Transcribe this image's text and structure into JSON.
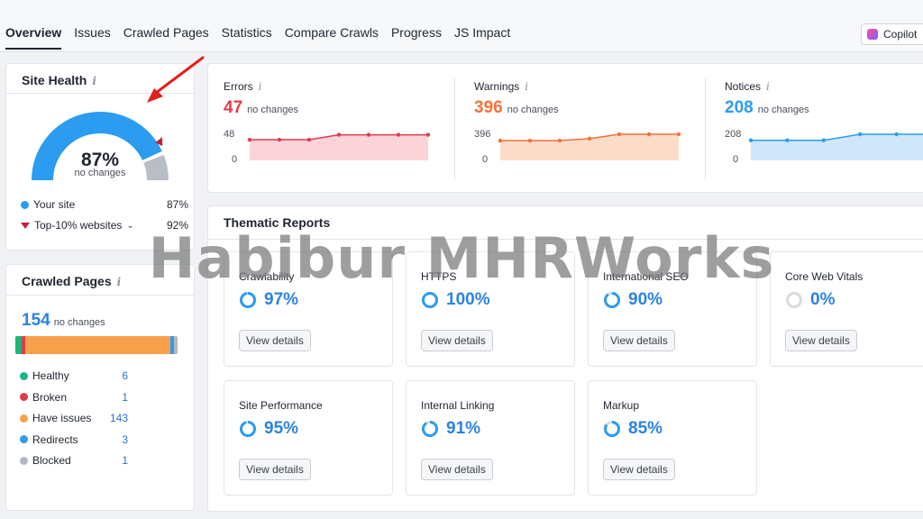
{
  "tabs": [
    "Overview",
    "Issues",
    "Crawled Pages",
    "Statistics",
    "Compare Crawls",
    "Progress",
    "JS Impact"
  ],
  "copilot": {
    "label": "Copilot"
  },
  "site_health": {
    "title": "Site Health",
    "info_icon": "i",
    "percent": "87%",
    "note": "no changes",
    "gauge_fraction": 0.87,
    "legend": [
      {
        "label": "Your site",
        "value": "87%",
        "color": "#2b9cf0"
      },
      {
        "label": "Top-10% websites",
        "value": "92%",
        "color": "#c4203b"
      }
    ]
  },
  "crawled_pages": {
    "title": "Crawled Pages",
    "info_icon": "i",
    "total": "154",
    "note": "no changes",
    "stats": [
      {
        "label": "Healthy",
        "count": "6",
        "color": "#1db57a"
      },
      {
        "label": "Broken",
        "count": "1",
        "color": "#e23b4a"
      },
      {
        "label": "Have issues",
        "count": "143",
        "color": "#f7a14c"
      },
      {
        "label": "Redirects",
        "count": "3",
        "color": "#2b9cf0"
      },
      {
        "label": "Blocked",
        "count": "1",
        "color": "#b3b8c2"
      }
    ]
  },
  "metrics": [
    {
      "label": "Errors",
      "value": "47",
      "note": "no changes",
      "color": "#e23b4a",
      "fill": "#fbd3d8",
      "axis_top": "48",
      "axis_bottom": "0",
      "series": [
        38,
        38,
        38,
        47,
        47,
        47,
        47
      ]
    },
    {
      "label": "Warnings",
      "value": "396",
      "note": "no changes",
      "color": "#f2723a",
      "fill": "#fcdcc8",
      "axis_top": "396",
      "axis_bottom": "0",
      "series": [
        300,
        300,
        300,
        330,
        396,
        396,
        396
      ]
    },
    {
      "label": "Notices",
      "value": "208",
      "note": "no changes",
      "color": "#2b9cf0",
      "fill": "#cfe6fb",
      "axis_top": "208",
      "axis_bottom": "0",
      "series": [
        160,
        160,
        160,
        208,
        208,
        208
      ]
    }
  ],
  "thematic": {
    "title": "Thematic Reports",
    "button_label": "View details",
    "reports": [
      {
        "name": "Crawlability",
        "score": "97%",
        "fraction": 0.97
      },
      {
        "name": "HTTPS",
        "score": "100%",
        "fraction": 1.0
      },
      {
        "name": "International SEO",
        "score": "90%",
        "fraction": 0.9
      },
      {
        "name": "Core Web Vitals",
        "score": "0%",
        "fraction": 0.0
      },
      {
        "name": "Site Performance",
        "score": "95%",
        "fraction": 0.95
      },
      {
        "name": "Internal Linking",
        "score": "91%",
        "fraction": 0.91
      },
      {
        "name": "Markup",
        "score": "85%",
        "fraction": 0.85
      }
    ]
  },
  "watermark": "Habibur MHRWorks",
  "annotation_arrow_color": "#e0201f"
}
